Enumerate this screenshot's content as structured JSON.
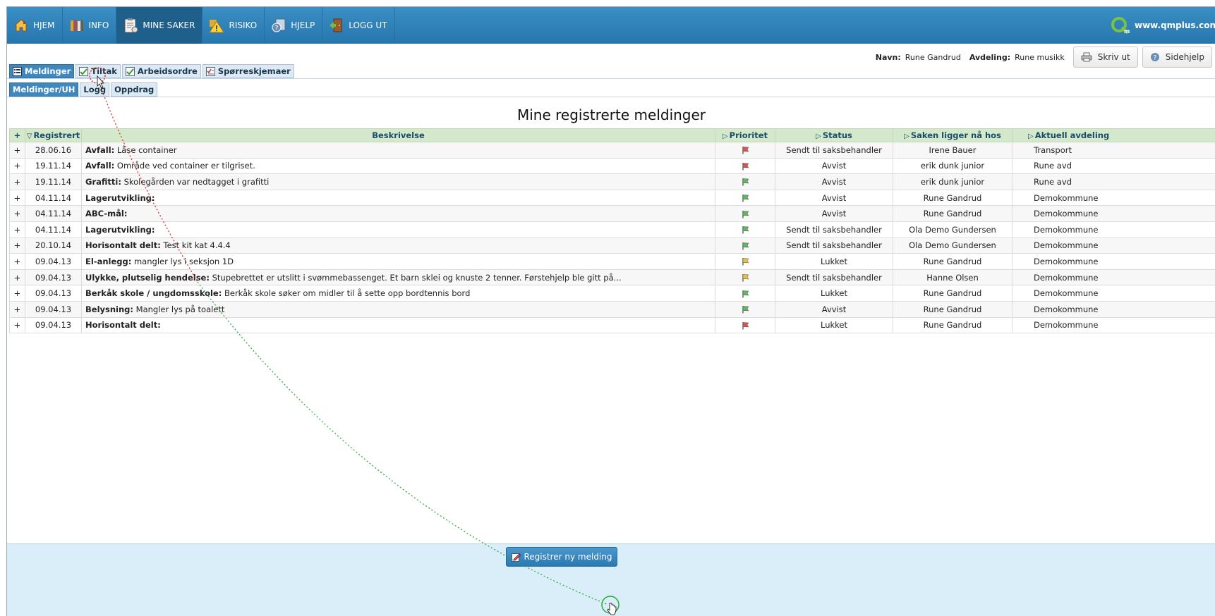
{
  "nav": {
    "items": [
      {
        "label": "HJEM",
        "icon": "home-icon"
      },
      {
        "label": "INFO",
        "icon": "books-icon"
      },
      {
        "label": "MINE SAKER",
        "icon": "clipboard-icon",
        "active": true
      },
      {
        "label": "RISIKO",
        "icon": "warning-icon"
      },
      {
        "label": "HJELP",
        "icon": "help-icon"
      },
      {
        "label": "LOGG UT",
        "icon": "logout-door-icon"
      }
    ],
    "site": "www.qmplus.con"
  },
  "info": {
    "name_label": "Navn:",
    "name_value": "Rune Gandrud",
    "dept_label": "Avdeling:",
    "dept_value": "Rune musikk",
    "print_label": "Skriv ut",
    "help_label": "Sidehjelp"
  },
  "tabs": [
    {
      "label": "Meldinger",
      "active": true
    },
    {
      "label": "Tiltak"
    },
    {
      "label": "Arbeidsordre"
    },
    {
      "label": "Spørreskjemaer"
    }
  ],
  "subtabs": [
    {
      "label": "Meldinger/UH",
      "active": true
    },
    {
      "label": "Logg"
    },
    {
      "label": "Oppdrag"
    }
  ],
  "page_title": "Mine registrerte meldinger",
  "table": {
    "headers": {
      "expand": "+",
      "registered": "Registrert",
      "description": "Beskrivelse",
      "priority": "Prioritet",
      "status": "Status",
      "holder": "Saken ligger nå hos",
      "department": "Aktuell avdeling"
    },
    "rows": [
      {
        "expand": "+",
        "date": "28.06.16",
        "cat": "Avfall:",
        "text": "Låse container",
        "flag": "#d9534f",
        "status": "Sendt til saksbehandler",
        "holder": "Irene Bauer",
        "dept": "Transport"
      },
      {
        "expand": "+",
        "date": "19.11.14",
        "cat": "Avfall:",
        "text": "Område ved container er tilgriset.",
        "flag": "#d9534f",
        "status": "Avvist",
        "holder": "erik dunk junior",
        "dept": "Rune avd"
      },
      {
        "expand": "+",
        "date": "19.11.14",
        "cat": "Grafitti:",
        "text": "Skolegården var nedtagget i grafitti",
        "flag": "#5cb85c",
        "status": "Avvist",
        "holder": "erik dunk junior",
        "dept": "Rune avd"
      },
      {
        "expand": "+",
        "date": "04.11.14",
        "cat": "Lagerutvikling:",
        "text": "",
        "flag": "#5cb85c",
        "status": "Avvist",
        "holder": "Rune Gandrud",
        "dept": "Demokommune"
      },
      {
        "expand": "+",
        "date": "04.11.14",
        "cat": "ABC-mål:",
        "text": "",
        "flag": "#5cb85c",
        "status": "Avvist",
        "holder": "Rune Gandrud",
        "dept": "Demokommune"
      },
      {
        "expand": "+",
        "date": "04.11.14",
        "cat": "Lagerutvikling:",
        "text": "",
        "flag": "#5cb85c",
        "status": "Sendt til saksbehandler",
        "holder": "Ola Demo Gundersen",
        "dept": "Demokommune"
      },
      {
        "expand": "+",
        "date": "20.10.14",
        "cat": "Horisontalt delt:",
        "text": "Test kit kat 4.4.4",
        "flag": "#5cb85c",
        "status": "Sendt til saksbehandler",
        "holder": "Ola Demo Gundersen",
        "dept": "Demokommune"
      },
      {
        "expand": "+",
        "date": "09.04.13",
        "cat": "El-anlegg:",
        "text": "mangler lys i seksjon 1D",
        "flag": "#e8c23a",
        "status": "Lukket",
        "holder": "Rune Gandrud",
        "dept": "Demokommune"
      },
      {
        "expand": "+",
        "date": "09.04.13",
        "cat": "Ulykke, plutselig hendelse:",
        "text": "Stupebrettet er utslitt i svømmebassenget. Et barn sklei og knuste 2 tenner. Førstehjelp ble gitt på...",
        "flag": "#e8c23a",
        "status": "Sendt til saksbehandler",
        "holder": "Hanne Olsen",
        "dept": "Demokommune"
      },
      {
        "expand": "+",
        "date": "09.04.13",
        "cat": "Berkåk skole / ungdomsskole:",
        "text": "Berkåk skole søker om midler til å sette opp bordtennis bord",
        "flag": "#5cb85c",
        "status": "Lukket",
        "holder": "Rune Gandrud",
        "dept": "Demokommune"
      },
      {
        "expand": "+",
        "date": "09.04.13",
        "cat": "Belysning:",
        "text": "Mangler lys på toalett",
        "flag": "#5cb85c",
        "status": "Avvist",
        "holder": "Rune Gandrud",
        "dept": "Demokommune"
      },
      {
        "expand": "+",
        "date": "09.04.13",
        "cat": "Horisontalt delt:",
        "text": "",
        "flag": "#d9534f",
        "status": "Lukket",
        "holder": "Rune Gandrud",
        "dept": "Demokommune"
      }
    ]
  },
  "register_button": "Registrer ny melding",
  "colors": {
    "nav": "#2f83ba",
    "header_row": "#d4e9c9",
    "bottom_bar": "#d9eef8",
    "primary_button": "#3a88c0"
  }
}
